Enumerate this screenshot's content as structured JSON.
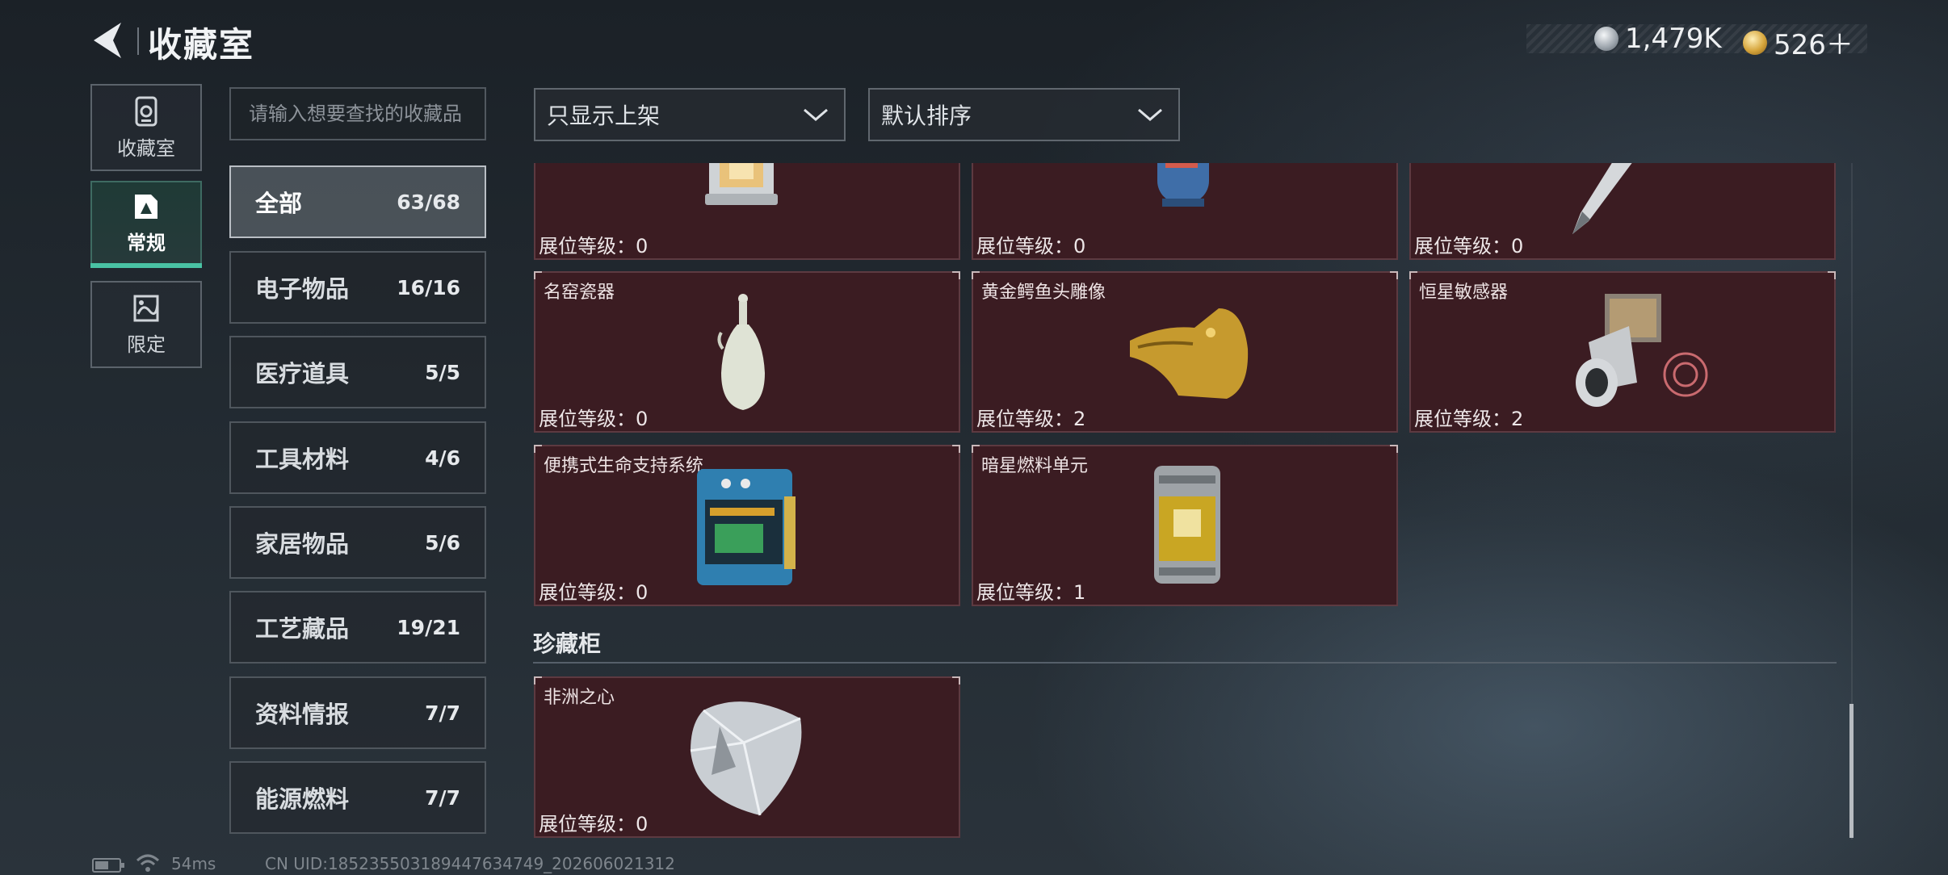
{
  "header": {
    "title": "收藏室"
  },
  "currency": [
    {
      "icon": "silver-coin-icon",
      "value": "1,479K"
    },
    {
      "icon": "gold-coin-icon",
      "value": "526＋"
    }
  ],
  "nav": [
    {
      "label": "收藏室",
      "icon": "collection-room-icon"
    },
    {
      "label": "常规",
      "icon": "regular-icon",
      "active": true
    },
    {
      "label": "限定",
      "icon": "limited-icon"
    }
  ],
  "search": {
    "placeholder": "请输入想要查找的收藏品"
  },
  "categories": [
    {
      "name": "全部",
      "count": "63/68",
      "active": true
    },
    {
      "name": "电子物品",
      "count": "16/16"
    },
    {
      "name": "医疗道具",
      "count": "5/5"
    },
    {
      "name": "工具材料",
      "count": "4/6"
    },
    {
      "name": "家居物品",
      "count": "5/6"
    },
    {
      "name": "工艺藏品",
      "count": "19/21"
    },
    {
      "name": "资料情报",
      "count": "7/7"
    },
    {
      "name": "能源燃料",
      "count": "7/7"
    }
  ],
  "filters": {
    "shelf_filter": "只显示上架",
    "sort": "默认排序"
  },
  "level_label": "展位等级：",
  "items_row0": [
    {
      "name": "",
      "level": "0"
    },
    {
      "name": "",
      "level": "0"
    },
    {
      "name": "",
      "level": "0"
    }
  ],
  "items": [
    {
      "name": "名窑瓷器",
      "level": "0"
    },
    {
      "name": "黄金鳄鱼头雕像",
      "level": "2"
    },
    {
      "name": "恒星敏感器",
      "level": "2"
    },
    {
      "name": "便携式生命支持系统",
      "level": "0"
    },
    {
      "name": "暗星燃料单元",
      "level": "1"
    }
  ],
  "treasure": {
    "section_title": "珍藏柜",
    "items": [
      {
        "name": "非洲之心",
        "level": "0"
      }
    ]
  },
  "footer": {
    "latency": "54ms",
    "uid": "CN UID:1852355031894476347​49_202606021312"
  }
}
